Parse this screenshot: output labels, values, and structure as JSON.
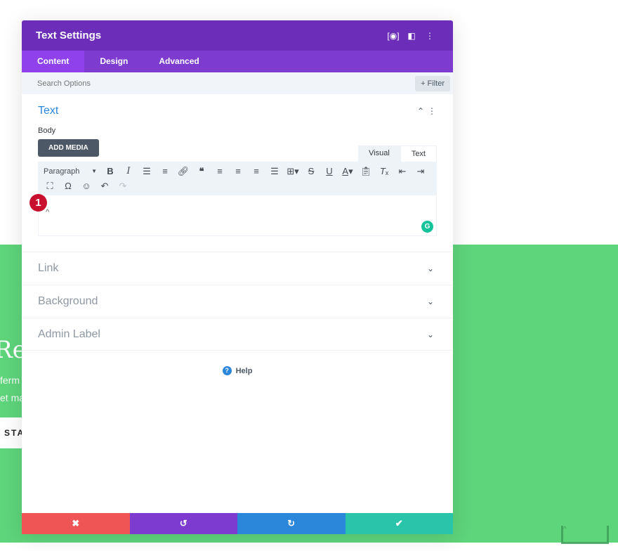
{
  "background": {
    "hero_title": "Re",
    "hero_lines": [
      "ferm",
      "et ma"
    ],
    "hero_button": "STA",
    "accent_green": "#5ed47b"
  },
  "modal": {
    "title": "Text Settings",
    "header_icons": [
      "focus-mode-icon",
      "sidebar-toggle-icon",
      "more-options-icon"
    ],
    "tabs": [
      {
        "label": "Content",
        "active": true
      },
      {
        "label": "Design",
        "active": false
      },
      {
        "label": "Advanced",
        "active": false
      }
    ],
    "search": {
      "placeholder": "Search Options",
      "value": ""
    },
    "filter_label": "Filter",
    "text_section": {
      "title": "Text",
      "body_label": "Body",
      "add_media_label": "ADD MEDIA",
      "editor_tabs": [
        "Visual",
        "Text"
      ],
      "format_select": "Paragraph",
      "editor_content": "^",
      "marker_number": "1"
    },
    "collapsed_sections": [
      {
        "title": "Link"
      },
      {
        "title": "Background"
      },
      {
        "title": "Admin Label"
      }
    ],
    "help_label": "Help"
  },
  "footer": {
    "buttons": [
      {
        "name": "cancel",
        "color": "#ef5555"
      },
      {
        "name": "undo",
        "color": "#7e3bd0"
      },
      {
        "name": "redo",
        "color": "#2b87da"
      },
      {
        "name": "save",
        "color": "#29c4a9"
      }
    ]
  }
}
